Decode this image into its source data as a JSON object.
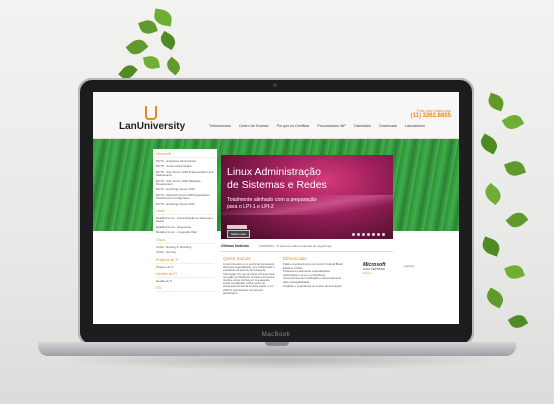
{
  "website": {
    "logo_text": "LanUniversity",
    "contact_line1": "Fale com Matrícula",
    "contact_phone": "(11) 3262.8805",
    "nav": [
      "Treinamentos",
      "Centro de Exames",
      "Por que os Certificar",
      "Procuradores IAP",
      "Calendário",
      "Downloads",
      "Laboratórios"
    ],
    "sidebar": {
      "sections": [
        {
          "title": "Microsoft",
          "items": [
            "MCTS - Enterprise Administrator",
            "MCTS - Server Administrator",
            "MCTS - SQL Server 2008 Implementation and Maintenance",
            "MCTS - SQL Server 2008 Database Development",
            "MCTS - Exchange Server 2010",
            "MCTS - Windows Server 2008 Applications Infrastructure Configuration",
            "MCTS - Exchange Server 2010"
          ]
        },
        {
          "title": "Linux",
          "items": [
            "MetaRed Linux - Administração de Sistemas e Redes",
            "MetaRed Linux - Segurança",
            "MetaRed Linux - Integração Web"
          ]
        },
        {
          "title": "Cisco",
          "items": [
            "CCNA - Routing & Switching",
            "CCNA - Security"
          ]
        },
        {
          "title": "Projetos de TI",
          "items": [
            "Projetos de TI"
          ]
        },
        {
          "title": "Gestão de TI",
          "items": [
            "Gestão de TI"
          ]
        },
        {
          "title": "ITIL",
          "items": []
        }
      ]
    },
    "banner": {
      "title_line1": "Linux Administração",
      "title_line2": "de Sistemas e Redes",
      "subtitle_line1": "Totalmente alinhado com a preparação",
      "subtitle_line2": "para o LPI-1 e LPI-2",
      "button_label": "Saiba mais"
    },
    "news": {
      "heading": "Últimas Notícias",
      "text": "10/03/2012 - Ti precisa mudar conteúdo de segurança"
    },
    "about": {
      "heading": "Quem Somos",
      "text": "A Lan University é um centro de treinamento altamente especializado, com profissionais e estudantes da área de Tecnologia da Informação (TI), que já somam 20 anos atuar na região de Zandpoort. Durante este tempo, recebeu vários prêmios por sua atuação, sendo considerado melhor centro de treinamento Novell da América Latina, e em 2006 foi premiada por seu primeiro atendimento..."
    },
    "differentials": {
      "heading": "Diferenciais",
      "items": [
        "Sólido reconhecimento de Centro Cultural Brasil Estados Unidos",
        "Professores altamente especializados",
        "Laboratórios novos e confortáveis",
        "Conveniência de localização e estacionamento",
        "Alta empregabilidade",
        "Tradição e experiência no ensino de tecnologia"
      ]
    },
    "partner": {
      "name": "Microsoft",
      "line": "GOLD CERTIFIED",
      "tag": "Partner",
      "side": "Learning"
    }
  },
  "laptop_brand": "MacBook"
}
